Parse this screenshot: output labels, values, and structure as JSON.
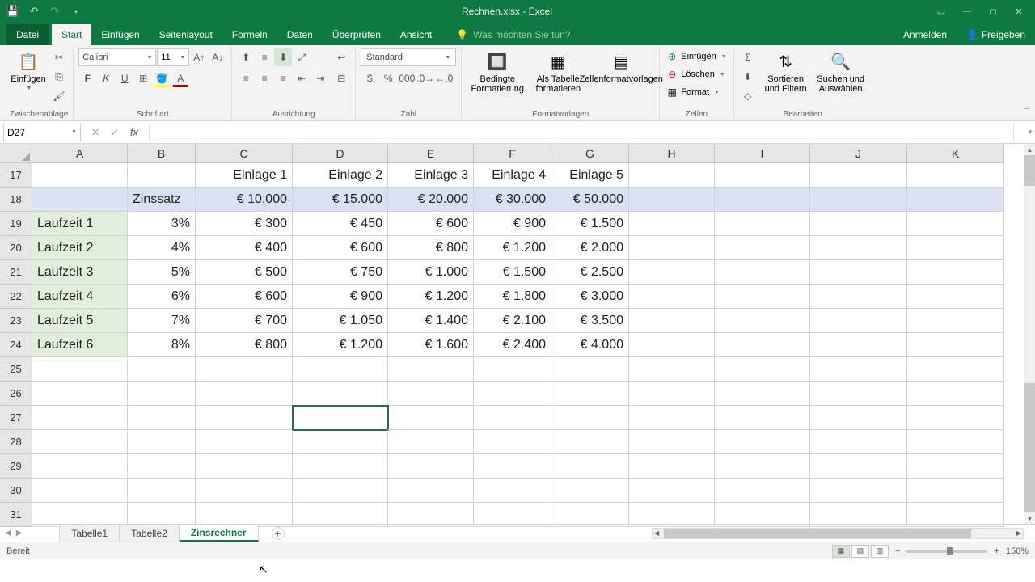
{
  "title": "Rechnen.xlsx - Excel",
  "ribbon": {
    "tabs": {
      "file": "Datei",
      "start": "Start",
      "insert": "Einfügen",
      "pagelayout": "Seitenlayout",
      "formulas": "Formeln",
      "data": "Daten",
      "review": "Überprüfen",
      "view": "Ansicht"
    },
    "tellme": "Was möchten Sie tun?",
    "signin": "Anmelden",
    "share": "Freigeben"
  },
  "groups": {
    "clipboard": {
      "label": "Zwischenablage",
      "paste": "Einfügen"
    },
    "font": {
      "label": "Schriftart",
      "fontname": "Calibri",
      "fontsize": "11"
    },
    "alignment": {
      "label": "Ausrichtung"
    },
    "number": {
      "label": "Zahl",
      "format": "Standard"
    },
    "styles": {
      "label": "Formatvorlagen",
      "conditional": "Bedingte Formatierung",
      "astable": "Als Tabelle formatieren",
      "cellstyles": "Zellenformatvorlagen"
    },
    "cells": {
      "label": "Zellen",
      "insert": "Einfügen",
      "delete": "Löschen",
      "format": "Format"
    },
    "editing": {
      "label": "Bearbeiten",
      "sort": "Sortieren und Filtern",
      "find": "Suchen und Auswählen"
    }
  },
  "namebox": "D27",
  "columns": [
    "A",
    "B",
    "C",
    "D",
    "E",
    "F",
    "G",
    "H",
    "I",
    "J",
    "K"
  ],
  "rownums": [
    17,
    18,
    19,
    20,
    21,
    22,
    23,
    24,
    25,
    26,
    27,
    28,
    29,
    30,
    31
  ],
  "cells": {
    "r17": {
      "C": "Einlage 1",
      "D": "Einlage 2",
      "E": "Einlage 3",
      "F": "Einlage 4",
      "G": "Einlage 5"
    },
    "r18": {
      "B": "Zinssatz",
      "C": "€ 10.000",
      "D": "€ 15.000",
      "E": "€ 20.000",
      "F": "€ 30.000",
      "G": "€ 50.000"
    },
    "r19": {
      "A": "Laufzeit 1",
      "B": "3%",
      "C": "€ 300",
      "D": "€ 450",
      "E": "€ 600",
      "F": "€ 900",
      "G": "€ 1.500"
    },
    "r20": {
      "A": "Laufzeit 2",
      "B": "4%",
      "C": "€ 400",
      "D": "€ 600",
      "E": "€ 800",
      "F": "€ 1.200",
      "G": "€ 2.000"
    },
    "r21": {
      "A": "Laufzeit 3",
      "B": "5%",
      "C": "€ 500",
      "D": "€ 750",
      "E": "€ 1.000",
      "F": "€ 1.500",
      "G": "€ 2.500"
    },
    "r22": {
      "A": "Laufzeit 4",
      "B": "6%",
      "C": "€ 600",
      "D": "€ 900",
      "E": "€ 1.200",
      "F": "€ 1.800",
      "G": "€ 3.000"
    },
    "r23": {
      "A": "Laufzeit 5",
      "B": "7%",
      "C": "€ 700",
      "D": "€ 1.050",
      "E": "€ 1.400",
      "F": "€ 2.100",
      "G": "€ 3.500"
    },
    "r24": {
      "A": "Laufzeit 6",
      "B": "8%",
      "C": "€ 800",
      "D": "€ 1.200",
      "E": "€ 1.600",
      "F": "€ 2.400",
      "G": "€ 4.000"
    }
  },
  "sheets": {
    "t1": "Tabelle1",
    "t2": "Tabelle2",
    "t3": "Zinsrechner"
  },
  "status": {
    "ready": "Bereit",
    "zoom": "150%"
  }
}
